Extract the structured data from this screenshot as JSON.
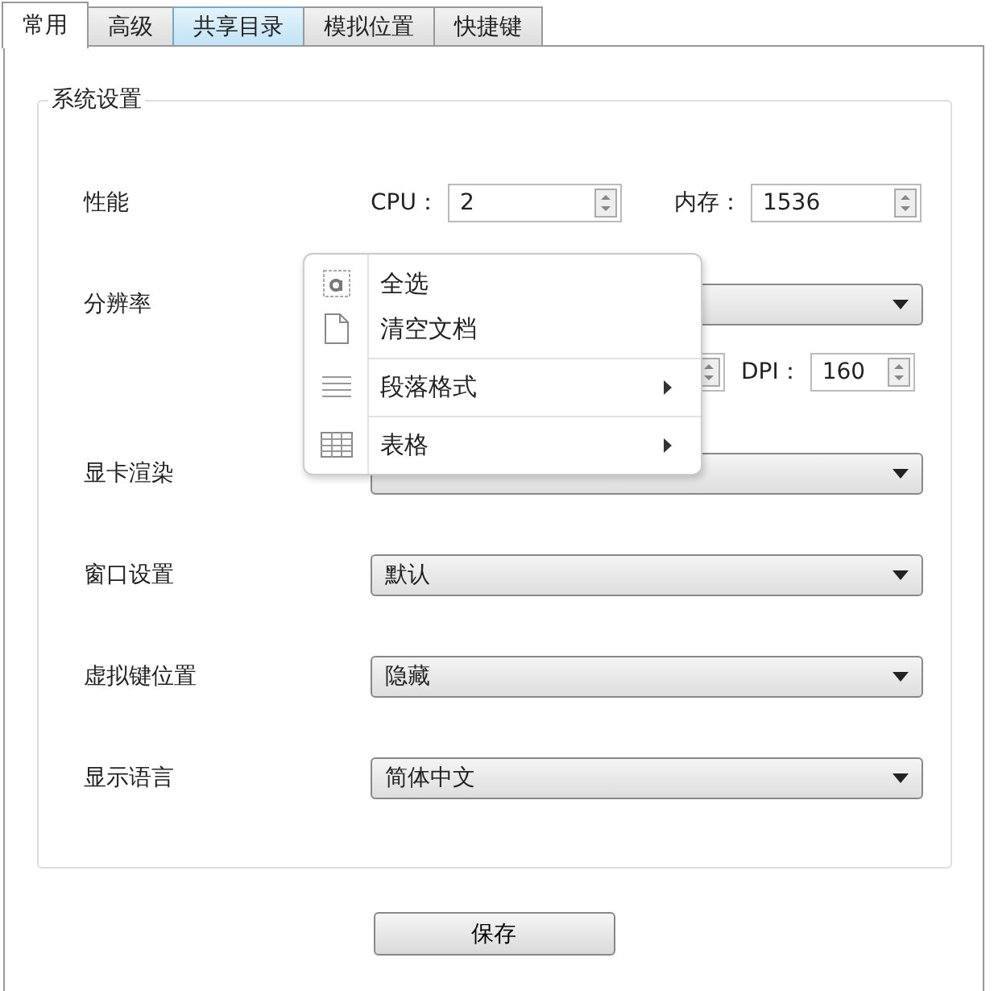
{
  "tabs": [
    {
      "label": "常用",
      "selected": true,
      "hovered": false
    },
    {
      "label": "高级",
      "selected": false,
      "hovered": false
    },
    {
      "label": "共享目录",
      "selected": false,
      "hovered": true
    },
    {
      "label": "模拟位置",
      "selected": false,
      "hovered": false
    },
    {
      "label": "快捷键",
      "selected": false,
      "hovered": false
    }
  ],
  "group": {
    "title": "系统设置",
    "rows": [
      {
        "kind": "spinners",
        "label": "性能",
        "fields": [
          {
            "label": "CPU：",
            "value": "2"
          },
          {
            "label": "内存：",
            "value": "1536"
          }
        ]
      },
      {
        "kind": "select",
        "label": "分辨率"
      },
      {
        "kind": "sub-spinners",
        "fields": [
          {
            "label": "DPI：",
            "value": "160"
          }
        ]
      },
      {
        "kind": "select",
        "label": "显卡渲染"
      },
      {
        "kind": "select",
        "label": "窗口设置",
        "value": "默认"
      },
      {
        "kind": "select",
        "label": "虚拟键位置",
        "value": "隐藏"
      },
      {
        "kind": "select",
        "label": "显示语言",
        "value": "简体中文"
      }
    ]
  },
  "save_button": "保存",
  "context_menu": [
    {
      "kind": "select-all",
      "label": "全选",
      "submenu": false,
      "separator_before": false
    },
    {
      "kind": "document",
      "label": "清空文档",
      "submenu": false,
      "separator_before": false
    },
    {
      "kind": "paragraph",
      "label": "段落格式",
      "submenu": true,
      "separator_before": true
    },
    {
      "kind": "table",
      "label": "表格",
      "submenu": true,
      "separator_before": true
    }
  ]
}
